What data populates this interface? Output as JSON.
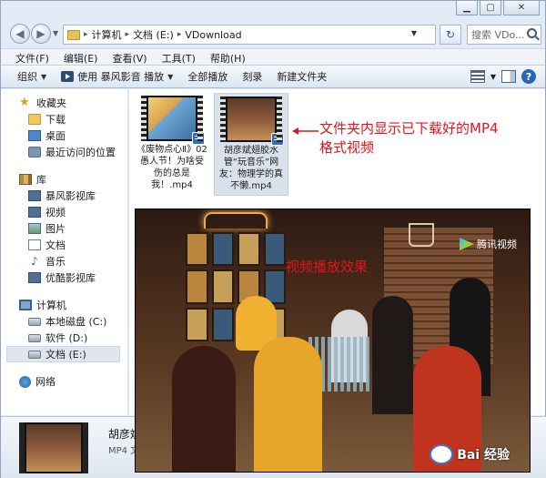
{
  "address": {
    "crumbs": [
      "计算机",
      "文档 (E:)",
      "VDownload"
    ]
  },
  "search": {
    "placeholder": "搜索 VDo..."
  },
  "menu": [
    "文件(F)",
    "编辑(E)",
    "查看(V)",
    "工具(T)",
    "帮助(H)"
  ],
  "toolbar": {
    "organize": "组织",
    "play_with": "使用 暴风影音 播放",
    "play_all": "全部播放",
    "burn": "刻录",
    "new_folder": "新建文件夹"
  },
  "nav": {
    "favorites": "收藏夹",
    "downloads": "下载",
    "desktop": "桌面",
    "recent": "最近访问的位置",
    "libraries": "库",
    "lib_baofeng": "暴风影视库",
    "lib_video": "视频",
    "lib_pictures": "图片",
    "lib_docs": "文档",
    "lib_music": "音乐",
    "lib_youku": "优酷影视库",
    "computer": "计算机",
    "drive_c": "本地磁盘 (C:)",
    "drive_d": "软件 (D:)",
    "drive_e": "文档 (E:)",
    "network": "网络"
  },
  "files": [
    {
      "name": "《废物点心Ⅱ》02愚人节！为啥受伤的总是我！.mp4"
    },
    {
      "name": "胡彦斌翅胶水管“玩音乐”网友：物理学的真不懒.mp4"
    }
  ],
  "annotations": {
    "files_shown": "文件夹内显示已下载好的MP4格式视频",
    "playback": "视频播放效果"
  },
  "video": {
    "logo": "腾讯视频",
    "watermark": "Bai 经验"
  },
  "details": {
    "name": "胡彦斌",
    "type": "MP4 文"
  }
}
